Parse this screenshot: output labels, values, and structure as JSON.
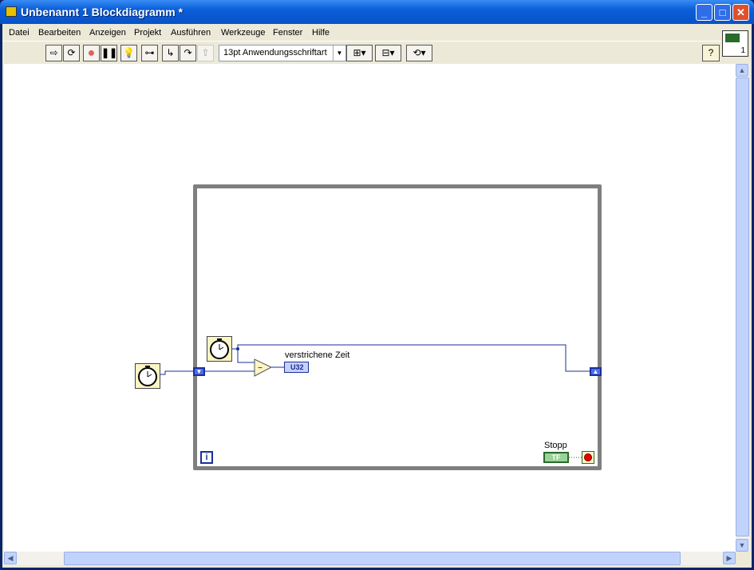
{
  "window": {
    "title": "Unbenannt 1 Blockdiagramm *",
    "min": "_",
    "max": "□",
    "close": "✕"
  },
  "menu": [
    "Datei",
    "Bearbeiten",
    "Anzeigen",
    "Projekt",
    "Ausführen",
    "Werkzeuge",
    "Fenster",
    "Hilfe"
  ],
  "toolbar": {
    "font": "13pt Anwendungsschriftart",
    "help": "?"
  },
  "icon_badge": "1",
  "diagram": {
    "indicator_label": "verstrichene Zeit",
    "indicator_type": "U32",
    "stop_label": "Stopp",
    "stop_type": "TF",
    "iteration": "i",
    "subtract": "−"
  }
}
